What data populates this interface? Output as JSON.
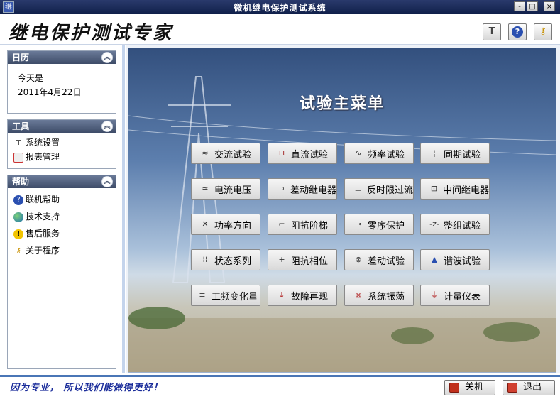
{
  "window": {
    "title": "微机继电保护测试系统",
    "icon_glyph": "继",
    "min": "-",
    "max": "□",
    "close": "×"
  },
  "header": {
    "logo_text": "继电保护测试专家",
    "btn_tools": "T",
    "btn_help": "?",
    "btn_key": "⚷"
  },
  "sidebar": {
    "calendar": {
      "title": "日历",
      "line1": "今天是",
      "line2": "2011年4月22日"
    },
    "tools": {
      "title": "工具",
      "items": [
        {
          "label": "系统设置"
        },
        {
          "label": "报表管理"
        }
      ]
    },
    "help": {
      "title": "帮助",
      "items": [
        {
          "label": "联机帮助"
        },
        {
          "label": "技术支持"
        },
        {
          "label": "售后服务"
        },
        {
          "label": "关于程序"
        }
      ]
    }
  },
  "main": {
    "title": "试验主菜单",
    "buttons": [
      {
        "label": "交流试验",
        "glyph": "≈"
      },
      {
        "label": "直流试验",
        "glyph": "⊓"
      },
      {
        "label": "频率试验",
        "glyph": "∿"
      },
      {
        "label": "同期试验",
        "glyph": "¦"
      },
      {
        "label": "电流电压",
        "glyph": "≃"
      },
      {
        "label": "差动继电器",
        "glyph": "⊃"
      },
      {
        "label": "反时限过流",
        "glyph": "⊥"
      },
      {
        "label": "中间继电器",
        "glyph": "⊡"
      },
      {
        "label": "功率方向",
        "glyph": "✕"
      },
      {
        "label": "阻抗阶梯",
        "glyph": "⌐"
      },
      {
        "label": "零序保护",
        "glyph": "⊸"
      },
      {
        "label": "整组试验",
        "glyph": "-z-"
      },
      {
        "label": "状态系列",
        "glyph": "⁞⁞"
      },
      {
        "label": "阻抗相位",
        "glyph": "+"
      },
      {
        "label": "差动试验",
        "glyph": "⊗"
      },
      {
        "label": "谐波试验",
        "glyph": "▲"
      },
      {
        "label": "工频变化量",
        "glyph": "≡"
      },
      {
        "label": "故障再现",
        "glyph": "↓"
      },
      {
        "label": "系统振荡",
        "glyph": "⊠"
      },
      {
        "label": "计量仪表",
        "glyph": "⏚"
      }
    ]
  },
  "footer": {
    "slogan": "因为专业， 所以我们能做得更好！",
    "shutdown": "关机",
    "exit": "退出"
  },
  "colors": {
    "accent": "#4a76b6",
    "panel_header": "#4e5c7a",
    "slogan": "#1a2c9a"
  }
}
